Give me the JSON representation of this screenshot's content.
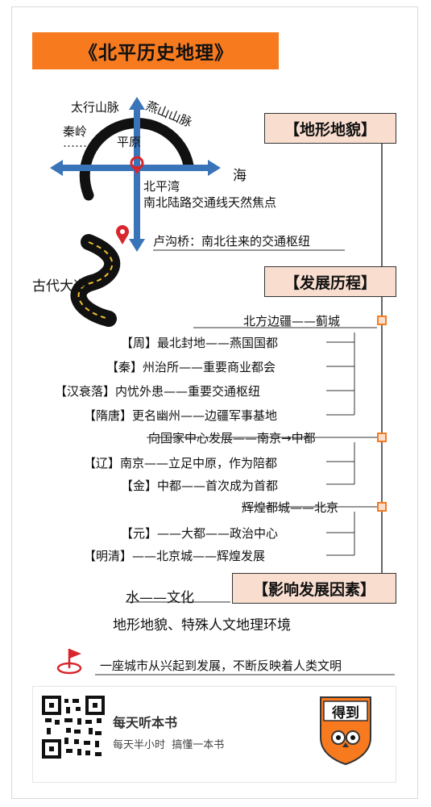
{
  "title": "《北平历史地理》",
  "map": {
    "taihang": "太行山脉",
    "yanshan": "燕山山脉",
    "qinling": "秦岭",
    "dots": "……",
    "plain": "平原",
    "sea": "海",
    "bay": "北平湾",
    "focus": "南北陆路交通线天然焦点",
    "lugou": "卢沟桥：南北往来的交通枢纽",
    "road": "古代大道"
  },
  "sections": {
    "terrain": "【地形地貌】",
    "development": "【发展历程】",
    "factors": "【影响发展因素】"
  },
  "stages": [
    {
      "heading": "北方边疆——蓟城",
      "items": [
        "【周】最北封地——燕国国都",
        "【秦】州治所——重要商业都会",
        "【汉衰落】内忧外患——重要交通枢纽",
        "【隋唐】更名幽州——边疆军事基地"
      ]
    },
    {
      "heading": "向国家中心发展——南京→中都",
      "items": [
        "【辽】南京——立足中原，作为陪都",
        "【金】中都——首次成为首都"
      ]
    },
    {
      "heading": "辉煌都城——北京",
      "items": [
        "【元】——大都——政治中心",
        "【明清】——北京城——辉煌发展"
      ]
    }
  ],
  "factors": {
    "water": "水——文化",
    "terrain": "地形地貌、特殊人文地理环境"
  },
  "summary": "一座城市从兴起到发展，不断反映着人类文明",
  "footer": {
    "line1": "每天听本书",
    "line2": "每天半小时  搞懂一本书",
    "logo": "得到"
  },
  "colors": {
    "orange": "#f77a1f",
    "peach": "#f9ded0",
    "blue": "#3a74b8",
    "red": "#d8262c"
  }
}
